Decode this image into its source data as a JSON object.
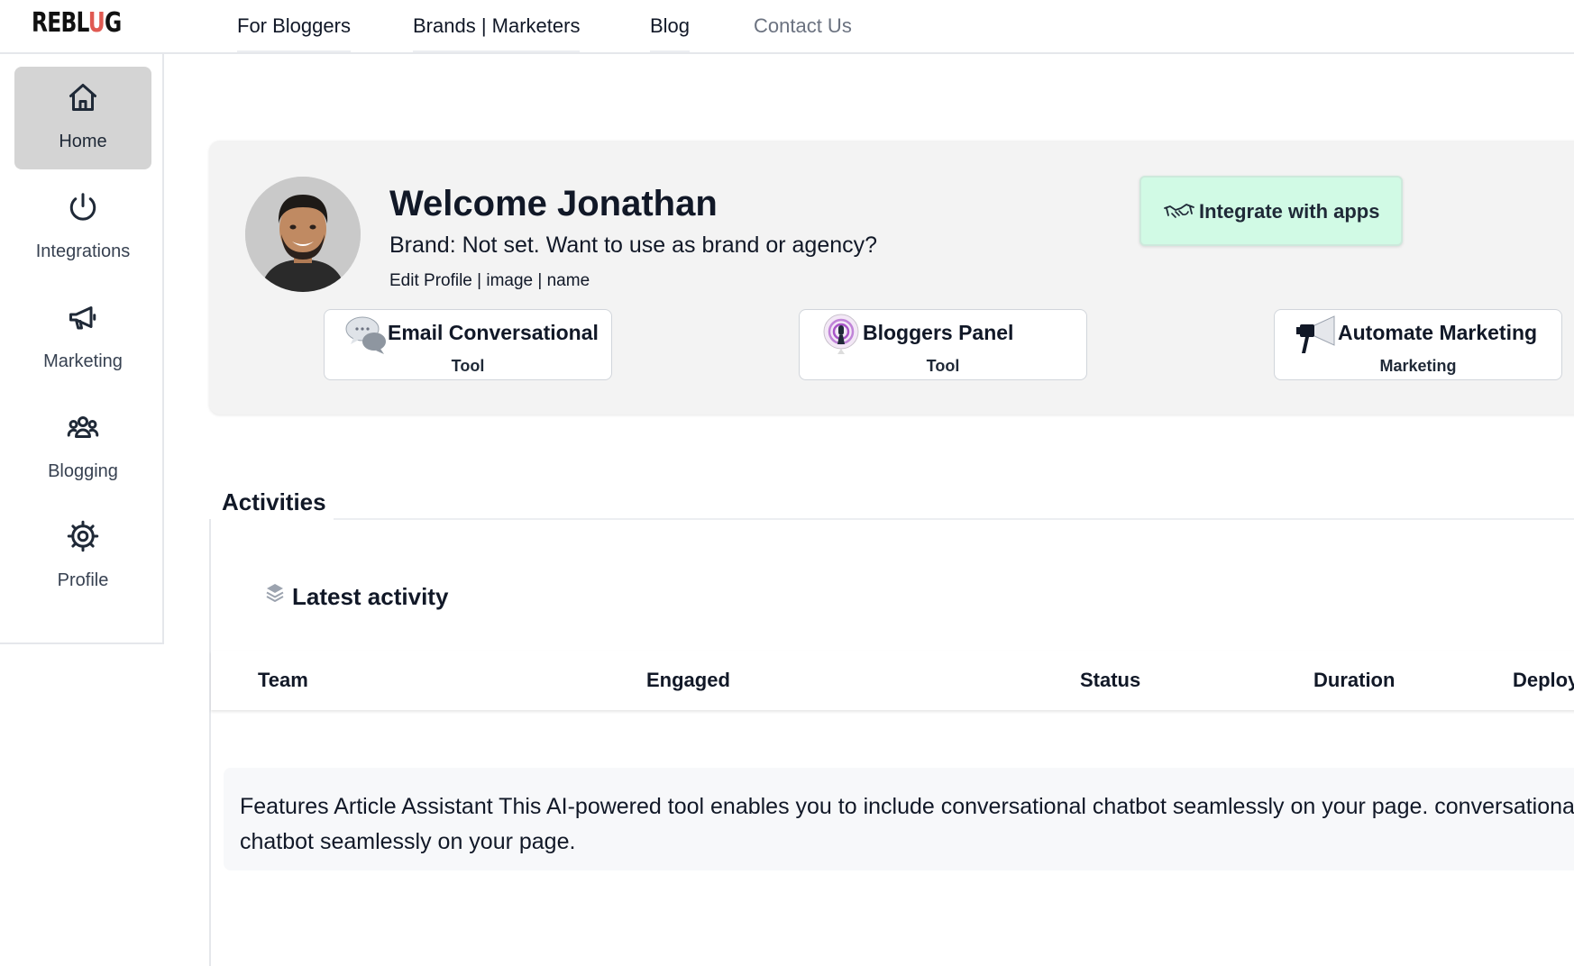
{
  "brand": {
    "logo_text_start": "REBL",
    "logo_text_accent": "U",
    "logo_text_end": "G",
    "accent_color": "#e05a52"
  },
  "topnav": {
    "links": [
      {
        "label": "For Bloggers"
      },
      {
        "label": "Brands | Marketers"
      },
      {
        "label": "Blog"
      },
      {
        "label": "Contact Us"
      }
    ]
  },
  "sidebar": {
    "items": [
      {
        "label": "Home",
        "icon": "home-icon",
        "active": true
      },
      {
        "label": "Integrations",
        "icon": "power-icon",
        "active": false
      },
      {
        "label": "Marketing",
        "icon": "megaphone-icon",
        "active": false
      },
      {
        "label": "Blogging",
        "icon": "users-icon",
        "active": false
      },
      {
        "label": "Profile",
        "icon": "gear-icon",
        "active": false
      }
    ]
  },
  "welcome": {
    "heading": "Welcome Jonathan",
    "brand_line": "Brand: Not set. Want to use as brand or agency?",
    "profile_links": "Edit Profile | image | name",
    "integrate_button": {
      "label": "Integrate with apps",
      "icon": "handshake-icon",
      "color": "#d1fae5"
    }
  },
  "tools": [
    {
      "name": "Email Conversational",
      "sub": "Tool",
      "icon": "speech-bubbles-icon"
    },
    {
      "name": "Bloggers Panel",
      "sub": "Tool",
      "icon": "podcast-icon"
    },
    {
      "name": "Automate Marketing",
      "sub": "Marketing",
      "icon": "megaphone-icon"
    }
  ],
  "activities": {
    "tab_label": "Activities",
    "latest_title": "Latest activity",
    "columns": [
      "Team",
      "Engaged",
      "Status",
      "Duration",
      "Deploy"
    ],
    "feature_text": "Features Article Assistant This AI-powered tool enables you to include conversational chatbot seamlessly on your page. conversational chatbot seamlessly on your page."
  }
}
